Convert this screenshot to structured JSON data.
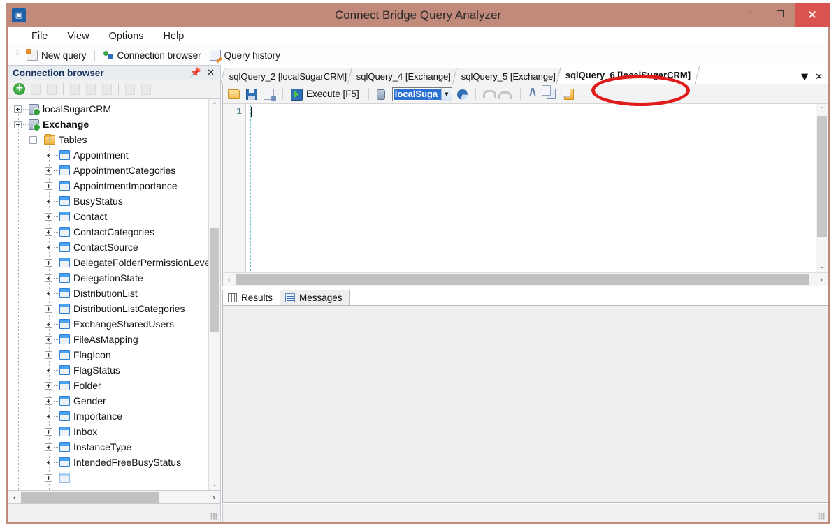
{
  "window": {
    "title": "Connect Bridge Query Analyzer",
    "app_icon": "app-logo-icon",
    "minimize": "–",
    "maximize": "❐",
    "close": "✕"
  },
  "menu": {
    "items": [
      {
        "label": "File"
      },
      {
        "label": "View"
      },
      {
        "label": "Options"
      },
      {
        "label": "Help"
      }
    ]
  },
  "main_toolbar": {
    "buttons": [
      {
        "label": "New query",
        "icon": "new-query-icon"
      },
      {
        "label": "Connection browser",
        "icon": "connection-browser-icon"
      },
      {
        "label": "Query history",
        "icon": "query-history-icon"
      }
    ]
  },
  "connection_browser": {
    "title": "Connection browser",
    "pin_icon": "pin-icon",
    "close_icon": "close-icon",
    "toolbar": [
      {
        "name": "add-connection",
        "icon": "add-circle-icon",
        "enabled": true
      },
      {
        "name": "edit-connection",
        "icon": "edit-icon",
        "enabled": false
      },
      {
        "name": "delete-connection",
        "icon": "delete-icon",
        "enabled": false
      },
      {
        "name": "script-object",
        "icon": "script-icon",
        "enabled": false
      },
      {
        "name": "copy-object",
        "icon": "copy-object-icon",
        "enabled": false
      },
      {
        "name": "export-object",
        "icon": "export-icon",
        "enabled": false
      },
      {
        "name": "refresh-tree",
        "icon": "refresh-icon",
        "enabled": false
      },
      {
        "name": "collapse-all",
        "icon": "collapse-icon",
        "enabled": false
      }
    ],
    "tree": [
      {
        "label": "localSugarCRM",
        "level": 0,
        "icon": "database-connected-icon",
        "expander": "plus",
        "bold": false
      },
      {
        "label": "Exchange",
        "level": 0,
        "icon": "database-connected-icon",
        "expander": "minus",
        "bold": true
      },
      {
        "label": "Tables",
        "level": 1,
        "icon": "folder-icon",
        "expander": "minus",
        "bold": false
      },
      {
        "label": "Appointment",
        "level": 2,
        "icon": "table-icon",
        "expander": "plus",
        "bold": false
      },
      {
        "label": "AppointmentCategories",
        "level": 2,
        "icon": "table-icon",
        "expander": "plus",
        "bold": false
      },
      {
        "label": "AppointmentImportance",
        "level": 2,
        "icon": "table-icon",
        "expander": "plus",
        "bold": false
      },
      {
        "label": "BusyStatus",
        "level": 2,
        "icon": "table-icon",
        "expander": "plus",
        "bold": false
      },
      {
        "label": "Contact",
        "level": 2,
        "icon": "table-icon",
        "expander": "plus",
        "bold": false
      },
      {
        "label": "ContactCategories",
        "level": 2,
        "icon": "table-icon",
        "expander": "plus",
        "bold": false
      },
      {
        "label": "ContactSource",
        "level": 2,
        "icon": "table-icon",
        "expander": "plus",
        "bold": false
      },
      {
        "label": "DelegateFolderPermissionLeve",
        "level": 2,
        "icon": "table-icon",
        "expander": "plus",
        "bold": false
      },
      {
        "label": "DelegationState",
        "level": 2,
        "icon": "table-icon",
        "expander": "plus",
        "bold": false
      },
      {
        "label": "DistributionList",
        "level": 2,
        "icon": "table-icon",
        "expander": "plus",
        "bold": false
      },
      {
        "label": "DistributionListCategories",
        "level": 2,
        "icon": "table-icon",
        "expander": "plus",
        "bold": false
      },
      {
        "label": "ExchangeSharedUsers",
        "level": 2,
        "icon": "table-icon",
        "expander": "plus",
        "bold": false
      },
      {
        "label": "FileAsMapping",
        "level": 2,
        "icon": "table-icon",
        "expander": "plus",
        "bold": false
      },
      {
        "label": "FlagIcon",
        "level": 2,
        "icon": "table-icon",
        "expander": "plus",
        "bold": false
      },
      {
        "label": "FlagStatus",
        "level": 2,
        "icon": "table-icon",
        "expander": "plus",
        "bold": false
      },
      {
        "label": "Folder",
        "level": 2,
        "icon": "table-icon",
        "expander": "plus",
        "bold": false
      },
      {
        "label": "Gender",
        "level": 2,
        "icon": "table-icon",
        "expander": "plus",
        "bold": false
      },
      {
        "label": "Importance",
        "level": 2,
        "icon": "table-icon",
        "expander": "plus",
        "bold": false
      },
      {
        "label": "Inbox",
        "level": 2,
        "icon": "table-icon",
        "expander": "plus",
        "bold": false
      },
      {
        "label": "InstanceType",
        "level": 2,
        "icon": "table-icon",
        "expander": "plus",
        "bold": false
      },
      {
        "label": "IntendedFreeBusyStatus",
        "level": 2,
        "icon": "table-icon",
        "expander": "plus",
        "bold": false
      },
      {
        "label": "",
        "level": 2,
        "icon": "table-icon",
        "expander": "plus",
        "bold": false
      }
    ],
    "scroll_up": "⌃",
    "scroll_down": "⌄",
    "scroll_left": "‹",
    "scroll_right": "›"
  },
  "query_tabs": {
    "tabs": [
      {
        "label": "sqlQuery_2 [localSugarCRM]",
        "active": false
      },
      {
        "label": "sqlQuery_4 [Exchange]",
        "active": false
      },
      {
        "label": "sqlQuery_5 [Exchange]",
        "active": false
      },
      {
        "label": "sqlQuery_6 [localSugarCRM]",
        "active": true
      }
    ],
    "list_icon": "chevron-down-icon",
    "close_icon": "close-icon",
    "list_glyph": "▼",
    "close_glyph": "✕"
  },
  "query_toolbar": {
    "open_label": "open-file-icon",
    "save_label": "save-icon",
    "save_all_label": "save-as-icon",
    "execute_label": "Execute [F5]",
    "connection_value": "localSuga",
    "dropdown_glyph": "▼",
    "refresh_label": "refresh-connection-icon",
    "undo_label": "undo-icon",
    "redo_label": "redo-icon",
    "cut_label": "cut-icon",
    "copy_label": "copy-icon",
    "paste_label": "paste-icon",
    "annotation": "red-oval-highlight"
  },
  "editor": {
    "line_numbers": [
      "1"
    ],
    "content": "",
    "scroll_up": "⌃",
    "scroll_down": "⌄",
    "scroll_left": "‹",
    "scroll_right": "›"
  },
  "results": {
    "tabs": [
      {
        "label": "Results",
        "icon": "grid-icon",
        "active": true
      },
      {
        "label": "Messages",
        "icon": "messages-icon",
        "active": false
      }
    ],
    "content": ""
  },
  "colors": {
    "title_bar": "#c28a7a",
    "close_button": "#d9534f",
    "accent_blue": "#2a6fd4",
    "annotation_red": "#e01b1b",
    "tree_selected": "#16325c"
  }
}
